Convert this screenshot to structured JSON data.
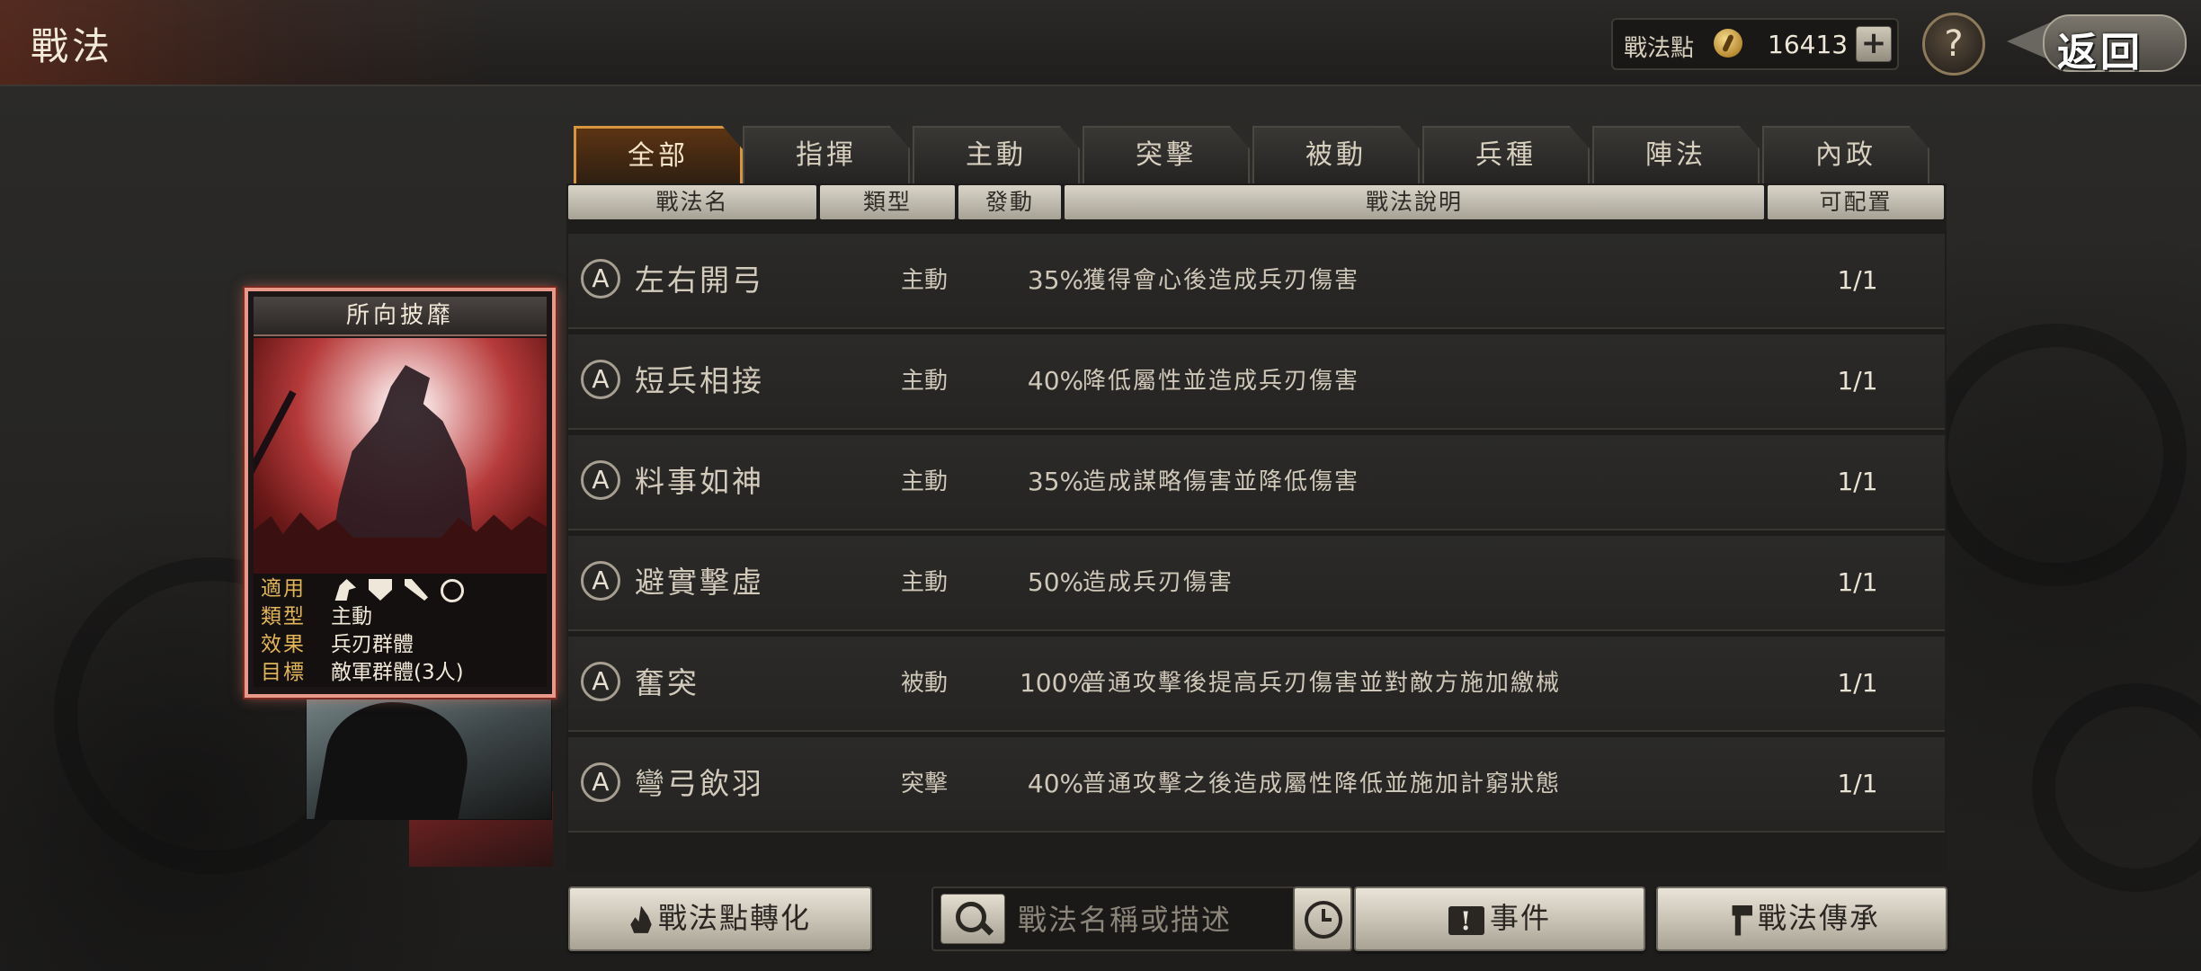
{
  "header": {
    "title": "戰法",
    "points_label": "戰法點",
    "points_value": "16413",
    "plus": "+",
    "help": "?",
    "back": "返回"
  },
  "tabs": [
    "全部",
    "指揮",
    "主動",
    "突擊",
    "被動",
    "兵種",
    "陣法",
    "內政"
  ],
  "active_tab": "全部",
  "table": {
    "headers": [
      "戰法名",
      "類型",
      "發動",
      "戰法說明",
      "可配置"
    ],
    "rows": [
      {
        "grade": "A",
        "name": "左右開弓",
        "type": "主動",
        "rate": "35%",
        "desc": "獲得會心後造成兵刃傷害",
        "slot": "1/1"
      },
      {
        "grade": "A",
        "name": "短兵相接",
        "type": "主動",
        "rate": "40%",
        "desc": "降低屬性並造成兵刃傷害",
        "slot": "1/1"
      },
      {
        "grade": "A",
        "name": "料事如神",
        "type": "主動",
        "rate": "35%",
        "desc": "造成謀略傷害並降低傷害",
        "slot": "1/1"
      },
      {
        "grade": "A",
        "name": "避實擊虛",
        "type": "主動",
        "rate": "50%",
        "desc": "造成兵刃傷害",
        "slot": "1/1"
      },
      {
        "grade": "A",
        "name": "奮突",
        "type": "被動",
        "rate": "100%",
        "desc": "普通攻擊後提高兵刃傷害並對敵方施加繳械",
        "slot": "1/1"
      },
      {
        "grade": "A",
        "name": "彎弓飲羽",
        "type": "突擊",
        "rate": "40%",
        "desc": "普通攻擊之後造成屬性降低並施加計窮狀態",
        "slot": "1/1"
      }
    ]
  },
  "card": {
    "title": "所向披靡",
    "applicable_label": "適用",
    "type_label": "類型",
    "type_value": "主動",
    "effect_label": "效果",
    "effect_value": "兵刃群體",
    "target_label": "目標",
    "target_value": "敵軍群體(3人)",
    "troop_icons": [
      "cavalry-icon",
      "shield-icon",
      "spear-icon",
      "wheel-icon"
    ]
  },
  "footer": {
    "convert_button": "戰法點轉化",
    "search_placeholder": "戰法名稱或描述",
    "events_button": "事件",
    "inherit_button": "戰法傳承"
  },
  "colors": {
    "active_tab_border": "#d8953e",
    "card_border": "#e79a8a",
    "card_label": "#e2b657"
  }
}
